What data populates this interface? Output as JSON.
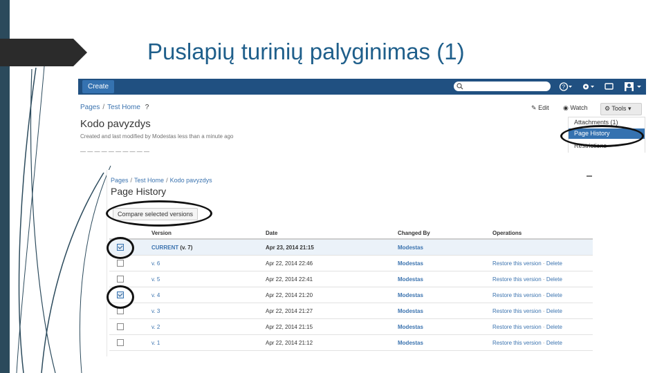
{
  "slide": {
    "title": "Puslapių turinių palyginimas (1)"
  },
  "confluence": {
    "create_label": "Create",
    "breadcrumb": [
      "Pages",
      "Test Home"
    ],
    "breadcrumb_extra": "?",
    "page_title": "Kodo pavyzdys",
    "created_line": "Created and last modified by Modestas less than a minute ago",
    "actions": {
      "edit_label": "Edit",
      "watch_label": "Watch",
      "tools_label": "Tools"
    },
    "tools_menu": {
      "items": [
        "Attachments (1)",
        "Page History",
        "Restrictions"
      ]
    },
    "icons": [
      "search-icon",
      "help-icon",
      "gear-icon",
      "notifications-icon",
      "user-icon"
    ]
  },
  "history": {
    "breadcrumb": [
      "Pages",
      "Test Home",
      "Kodo pavyzdys"
    ],
    "title": "Page History",
    "compare_label": "Compare selected versions",
    "columns": [
      "Version",
      "Date",
      "Changed By",
      "Operations"
    ],
    "current_suffix": "(v. 7)",
    "rows": [
      {
        "version": "CURRENT",
        "date": "Apr 23, 2014 21:15",
        "author": "Modestas",
        "restore": "",
        "delete": "",
        "checked": true
      },
      {
        "version": "v. 6",
        "date": "Apr 22, 2014 22:46",
        "author": "Modestas",
        "restore": "Restore this version",
        "delete": "Delete",
        "checked": false
      },
      {
        "version": "v. 5",
        "date": "Apr 22, 2014 22:41",
        "author": "Modestas",
        "restore": "Restore this version",
        "delete": "Delete",
        "checked": false
      },
      {
        "version": "v. 4",
        "date": "Apr 22, 2014 21:20",
        "author": "Modestas",
        "restore": "Restore this version",
        "delete": "Delete",
        "checked": true
      },
      {
        "version": "v. 3",
        "date": "Apr 22, 2014 21:27",
        "author": "Modestas",
        "restore": "Restore this version",
        "delete": "Delete",
        "checked": false
      },
      {
        "version": "v. 2",
        "date": "Apr 22, 2014 21:15",
        "author": "Modestas",
        "restore": "Restore this version",
        "delete": "Delete",
        "checked": false
      },
      {
        "version": "v. 1",
        "date": "Apr 22, 2014 21:12",
        "author": "Modestas",
        "restore": "Restore this version",
        "delete": "Delete",
        "checked": false
      }
    ]
  },
  "colors": {
    "title": "#1f5f8b",
    "band": "#2b4a5c",
    "header_bar": "#205081",
    "link": "#3b73af",
    "selected_menu": "#3572b0"
  }
}
